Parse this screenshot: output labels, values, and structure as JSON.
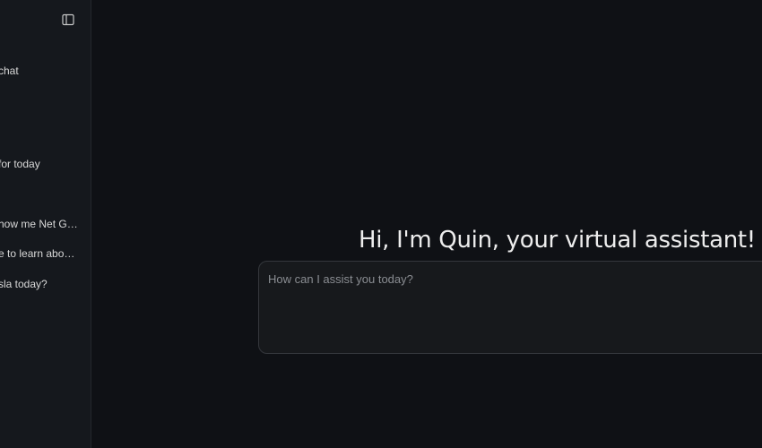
{
  "sidebar": {
    "toggle_icon": "sidebar-panel-icon",
    "new_chat_label": "chat",
    "items": [
      {
        "label": "for today"
      },
      {
        "label": "how me Net G…"
      },
      {
        "label": "e to learn abo…"
      },
      {
        "label": "sla today?"
      }
    ]
  },
  "main": {
    "greeting": "Hi, I'm Quin, your virtual assistant!",
    "prompt": {
      "placeholder": "How can I assist you today?",
      "value": ""
    }
  },
  "colors": {
    "background": "#0f1115",
    "sidebar_background": "#15181d",
    "input_background": "#17191c",
    "input_border": "#34373c",
    "text": "#ededed",
    "placeholder": "#8a8d92"
  }
}
